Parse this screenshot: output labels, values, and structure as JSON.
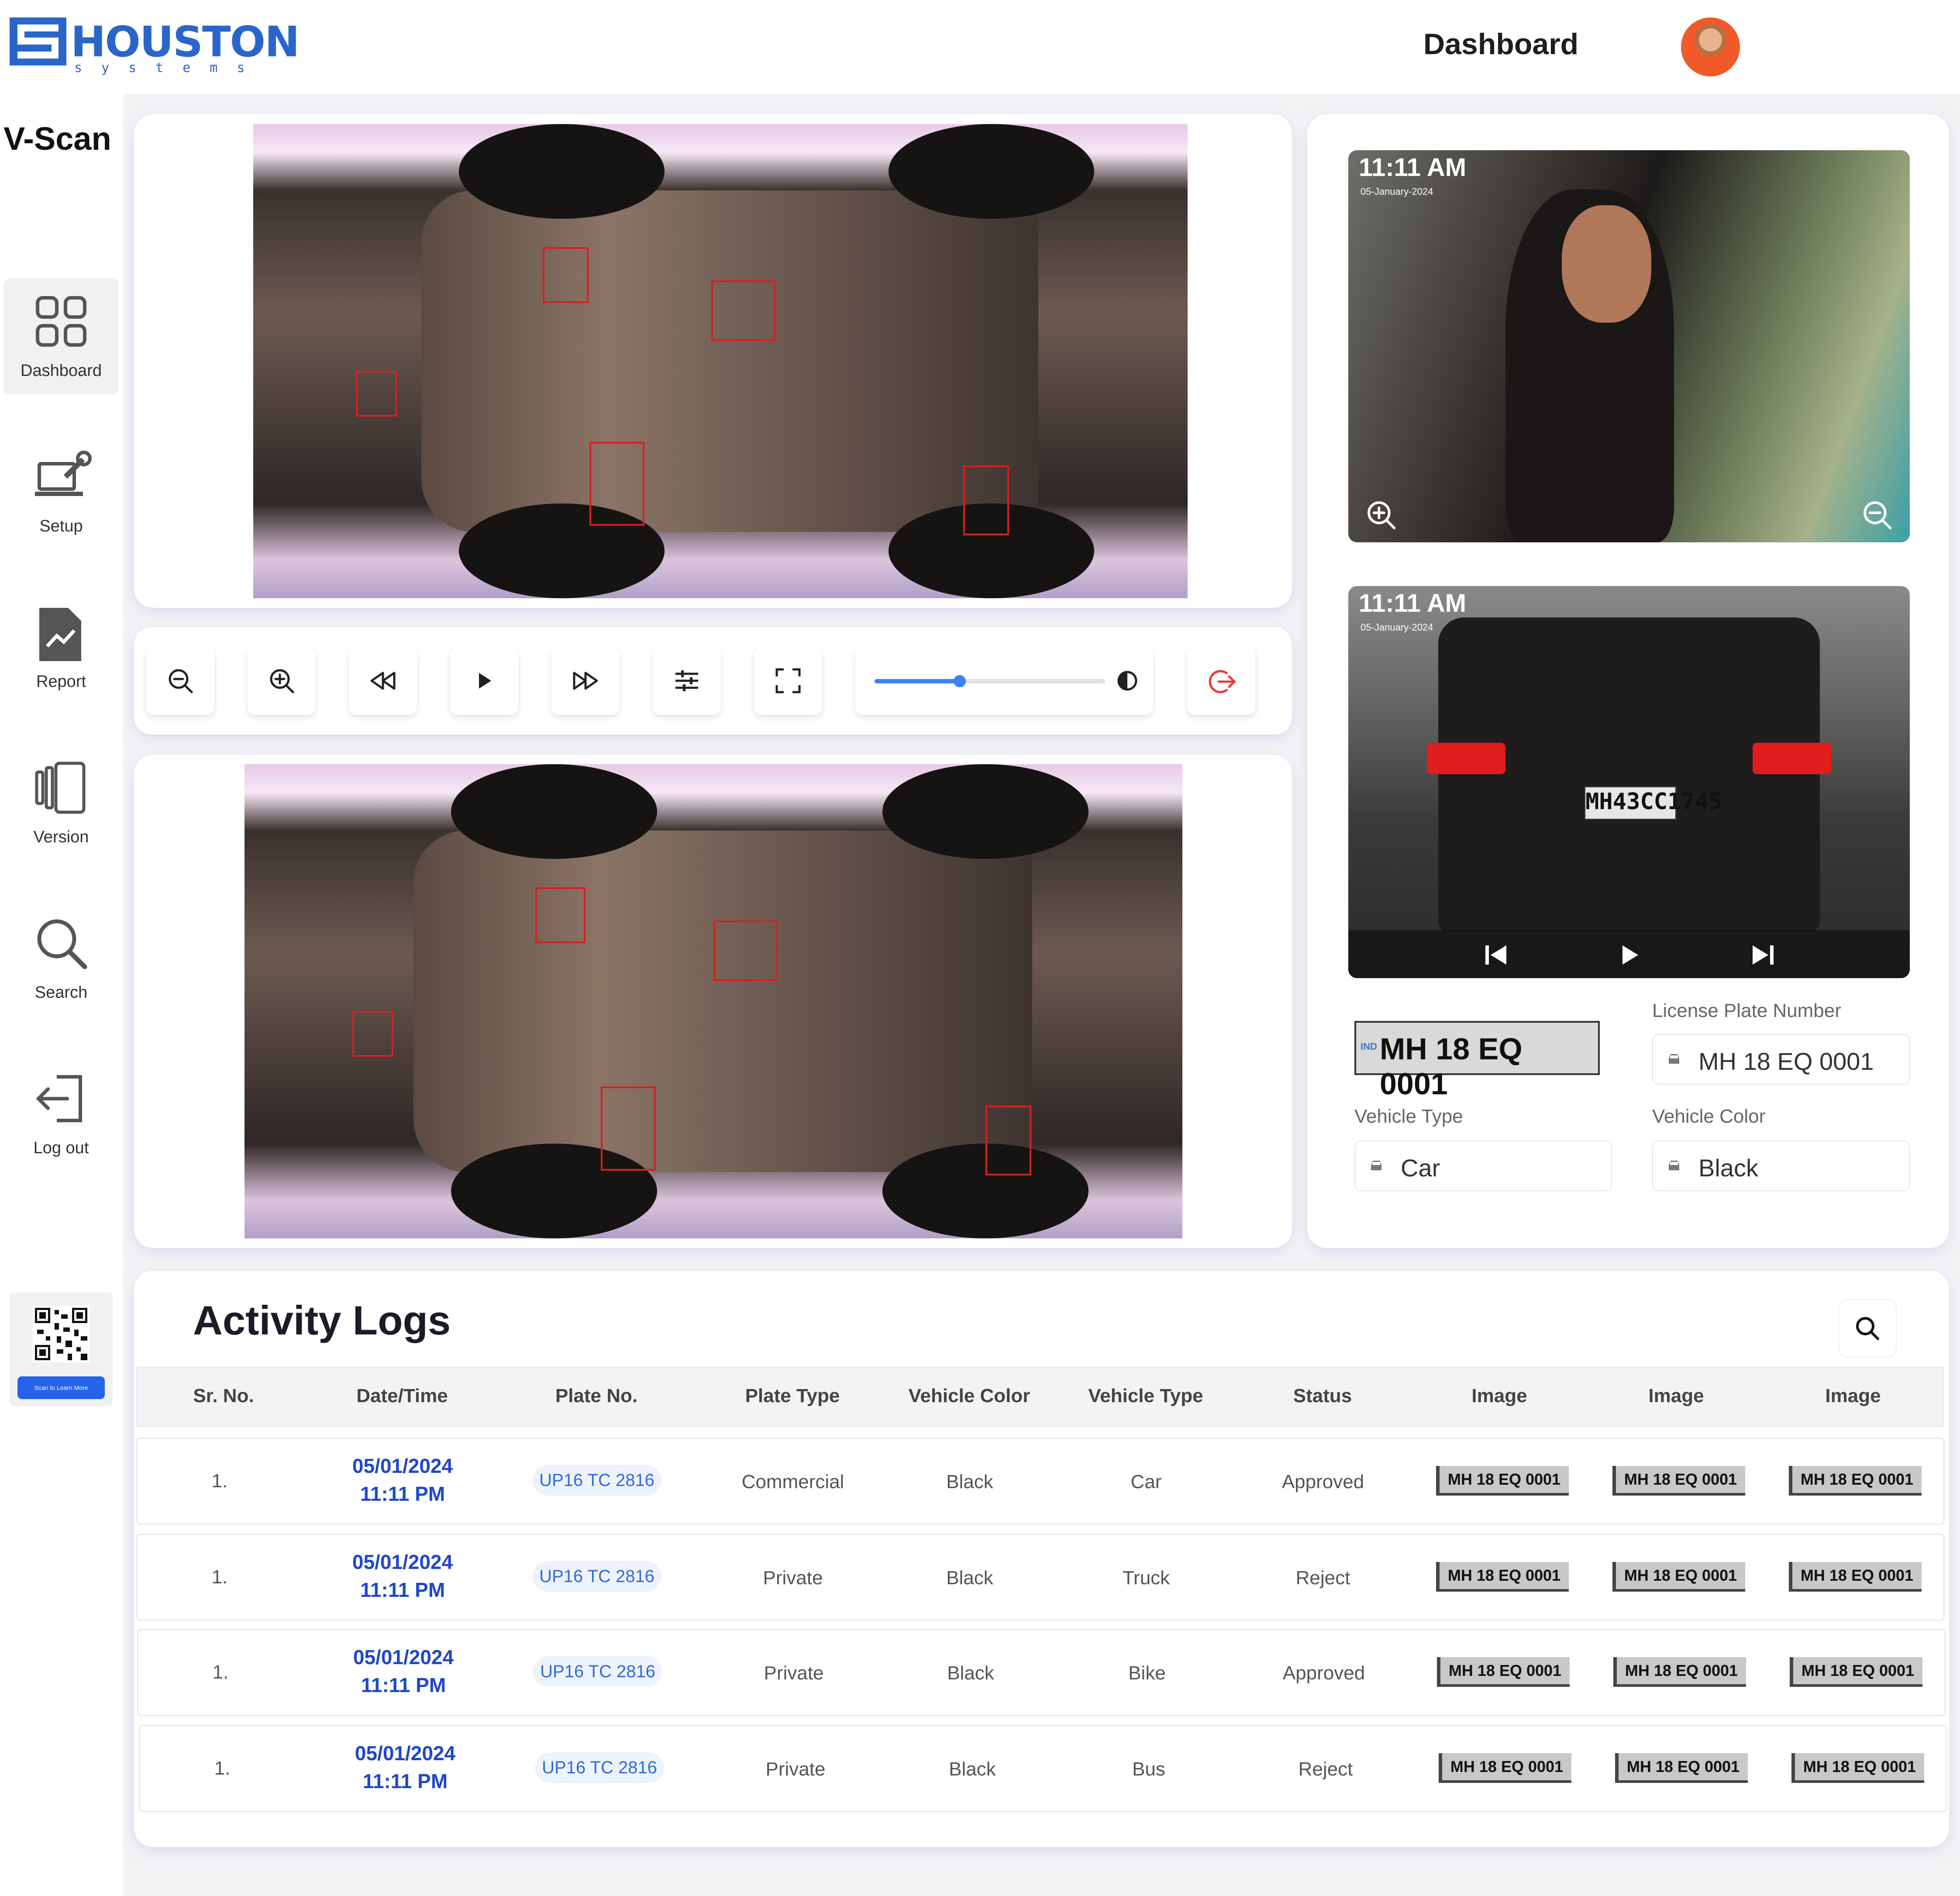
{
  "header": {
    "logo_text": "HOUSTON",
    "logo_subtext": "systems",
    "page_title": "Dashboard"
  },
  "sidebar": {
    "app_title": "V-Scan",
    "items": [
      {
        "label": "Dashboard",
        "icon": "grid-icon",
        "active": true
      },
      {
        "label": "Setup",
        "icon": "laptop-wrench-icon",
        "active": false
      },
      {
        "label": "Report",
        "icon": "report-chart-icon",
        "active": false
      },
      {
        "label": "Version",
        "icon": "version-panels-icon",
        "active": false
      },
      {
        "label": "Search",
        "icon": "search-icon",
        "active": false
      },
      {
        "label": "Log out",
        "icon": "logout-icon",
        "active": false
      }
    ],
    "qr_button": "Scan to Learn More"
  },
  "player": {
    "controls": [
      "zoom-out-icon",
      "zoom-in-icon",
      "rewind-icon",
      "play-icon",
      "fast-forward-icon",
      "adjust-icon",
      "fullscreen-icon"
    ],
    "slider_level": 0.37,
    "accent": "#3b82f6",
    "exit_color": "#e53935"
  },
  "cameras": {
    "driver": {
      "time": "11:11 AM",
      "date": "05-January-2024"
    },
    "rear": {
      "time": "11:11 AM",
      "date": "05-January-2024",
      "plate_on_car": "MH43CC1745"
    }
  },
  "vehicle": {
    "plate_image_text": "MH 18 EQ 0001",
    "plate_country": "IND",
    "license_label": "License Plate Number",
    "license_value": "MH 18 EQ 0001",
    "type_label": "Vehicle Type",
    "type_value": "Car",
    "color_label": "Vehicle Color",
    "color_value": "Black"
  },
  "logs": {
    "title": "Activity Logs",
    "columns": [
      "Sr. No.",
      "Date/Time",
      "Plate No.",
      "Plate Type",
      "Vehicle Color",
      "Vehicle Type",
      "Status",
      "Image",
      "Image",
      "Image"
    ],
    "rows": [
      {
        "sr": "1.",
        "date": "05/01/2024",
        "time": "11:11 PM",
        "plate": "UP16 TC 2816",
        "plate_type": "Commercial",
        "color": "Black",
        "vtype": "Car",
        "status": "Approved",
        "images": [
          "MH 18 EQ 0001",
          "MH 18 EQ 0001",
          "MH 18 EQ 0001"
        ]
      },
      {
        "sr": "1.",
        "date": "05/01/2024",
        "time": "11:11 PM",
        "plate": "UP16 TC 2816",
        "plate_type": "Private",
        "color": "Black",
        "vtype": "Truck",
        "status": "Reject",
        "images": [
          "MH 18 EQ 0001",
          "MH 18 EQ 0001",
          "MH 18 EQ 0001"
        ]
      },
      {
        "sr": "1.",
        "date": "05/01/2024",
        "time": "11:11 PM",
        "plate": "UP16 TC 2816",
        "plate_type": "Private",
        "color": "Black",
        "vtype": "Bike",
        "status": "Approved",
        "images": [
          "MH 18 EQ 0001",
          "MH 18 EQ 0001",
          "MH 18 EQ 0001"
        ]
      },
      {
        "sr": "1.",
        "date": "05/01/2024",
        "time": "11:11 PM",
        "plate": "UP16 TC 2816",
        "plate_type": "Private",
        "color": "Black",
        "vtype": "Bus",
        "status": "Reject",
        "images": [
          "MH 18 EQ 0001",
          "MH 18 EQ 0001",
          "MH 18 EQ 0001"
        ]
      }
    ]
  }
}
